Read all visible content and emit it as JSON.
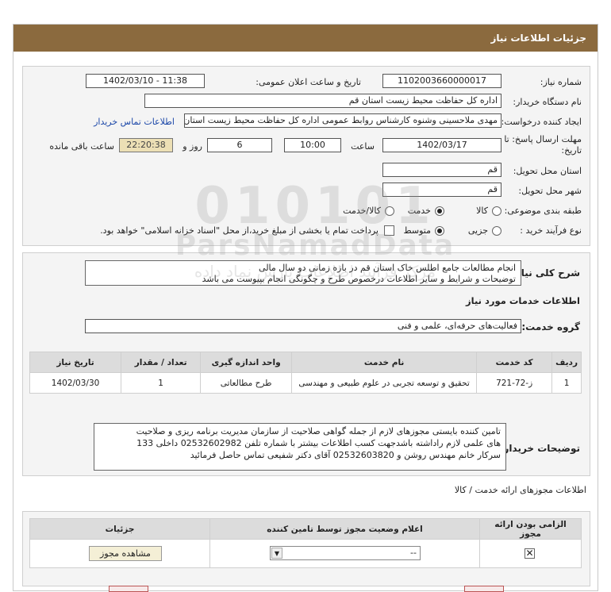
{
  "header": {
    "title": "جزئیات اطلاعات نیاز"
  },
  "fields": {
    "need_number_label": "شماره نیاز:",
    "need_number": "1102003660000017",
    "announce_label": "تاریخ و ساعت اعلان عمومی:",
    "announce_value": "1402/03/10 - 11:38",
    "buyer_org_label": "نام دستگاه خریدار:",
    "buyer_org": "اداره کل حفاظت محیط زیست استان قم",
    "requester_label": "ایجاد کننده درخواست:",
    "requester": "مهدی ملاحسینی وشنوه کارشناس روابط عمومی اداره کل حفاظت محیط زیست استان قم",
    "contact_link": "اطلاعات تماس خریدار",
    "deadline_label_1": "مهلت ارسال پاسخ: تا",
    "deadline_label_2": "تاریخ:",
    "deadline_date": "1402/03/17",
    "time_label": "ساعت",
    "deadline_time": "10:00",
    "days": "6",
    "days_label": "روز و",
    "remaining_time": "22:20:38",
    "remaining_label": "ساعت باقی مانده",
    "province_label": "استان محل تحویل:",
    "province": "قم",
    "city_label": "شهر محل تحویل:",
    "city": "قم",
    "category_label": "طبقه بندی موضوعی:",
    "category_options": [
      "کالا",
      "خدمت",
      "کالا/خدمت"
    ],
    "category_selected": "خدمت",
    "process_label": "نوع فرآیند خرید :",
    "process_options": [
      "جزیی",
      "متوسط"
    ],
    "process_selected": "متوسط",
    "payment_note": "پرداخت تمام یا بخشی از مبلغ خرید،از محل \"اسناد خزانه اسلامی\" خواهد بود."
  },
  "summary": {
    "label": "شرح کلی نیاز:",
    "line1": "انجام مطالعات جامع اطلس خاک استان قم در بازه زمانی دو سال مالی",
    "line2": "توضیحات و  شرایط و سایر اطلاعات درخصوص طرح و چگونگی انجام بپیوست می باشد"
  },
  "services": {
    "section_title": "اطلاعات خدمات مورد نیاز",
    "group_label": "گروه خدمت:",
    "group_value": "فعالیت‌های حرفه‌ای، علمی و فنی",
    "table": {
      "headers": [
        "ردیف",
        "کد خدمت",
        "نام خدمت",
        "واحد اندازه گیری",
        "تعداد / مقدار",
        "تاریخ نیاز"
      ],
      "rows": [
        [
          "1",
          "ز-72-721",
          "تحقیق و توسعه تجربی در علوم طبیعی و مهندسی",
          "طرح مطالعاتی",
          "1",
          "1402/03/30"
        ]
      ]
    }
  },
  "buyer_notes": {
    "label": "توضیحات خریدار:",
    "line1": "تامین کننده بایستی مجوزهای لازم از جمله گواهی صلاحیت از سازمان مدیریت برنامه ریزی و صلاحیت",
    "line2": "های علمی  لازم راداشته باشدجهت کسب اطلاعات بیشتر با شماره تلفن 02532602982 داخلی 133",
    "line3": "سرکار خانم مهندس روشن و  02532603820  آقای دکتر شفیعی تماس حاصل فرمائید"
  },
  "permits": {
    "section_title": "اطلاعات مجوزهای ارائه خدمت / کالا",
    "headers": [
      "الزامی بودن ارائه مجوز",
      "اعلام وضعیت مجوز توسط تامین کننده",
      "جزئیات"
    ],
    "status_value": "--",
    "view_button": "مشاهده مجوز"
  },
  "watermark": {
    "line1": "010101",
    "line2": "ParsNamadData",
    "line3": "مرکز فرآیند اطلاعات پارس نماد داده"
  },
  "colors": {
    "header": "#8b6a3e",
    "link": "#1b47a8",
    "shaded": "#ecdfb5"
  }
}
